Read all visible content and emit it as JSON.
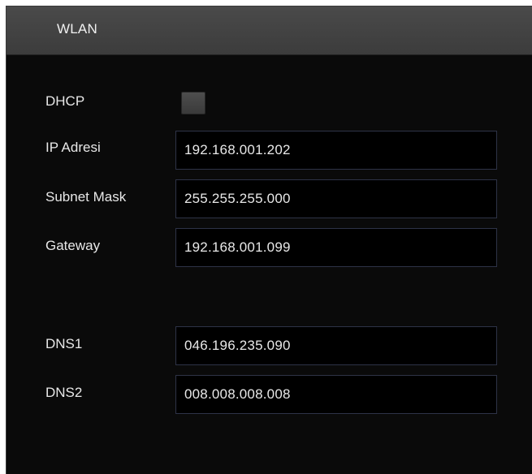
{
  "window": {
    "title": "WLAN"
  },
  "form": {
    "dhcp": {
      "label": "DHCP",
      "checked": false
    },
    "ip_address": {
      "label": "IP Adresi",
      "value": "192.168.001.202"
    },
    "subnet_mask": {
      "label": "Subnet Mask",
      "value": "255.255.255.000"
    },
    "gateway": {
      "label": "Gateway",
      "value": "192.168.001.099"
    },
    "dns1": {
      "label": "DNS1",
      "value": "046.196.235.090"
    },
    "dns2": {
      "label": "DNS2",
      "value": "008.008.008.008"
    }
  },
  "colors": {
    "panel_background": "#0a0a0a",
    "title_bar": "#444444",
    "field_border": "#2e3347",
    "text": "#e8e8e8"
  }
}
